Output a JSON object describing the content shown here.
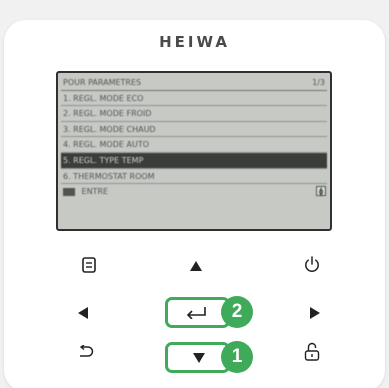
{
  "brand": {
    "name": "HEIWA"
  },
  "screen": {
    "header": {
      "title": "POUR PARAMETRES",
      "page": "1/3"
    },
    "items": [
      {
        "label": "1. REGL. MODE ECO"
      },
      {
        "label": "2. REGL. MODE FROID"
      },
      {
        "label": "3. REGL. MODE CHAUD"
      },
      {
        "label": "4. REGL. MODE AUTO"
      },
      {
        "label": "5. REGL. TYPE TEMP"
      },
      {
        "label": "6. THERMOSTAT ROOM"
      }
    ],
    "selected_index": 4,
    "footer": {
      "label": "ENTRE"
    }
  },
  "steps": {
    "enter_step": "2",
    "down_step": "1"
  },
  "colors": {
    "accent": "#3eaa5a",
    "screen_bg": "#c7c9c5",
    "selected_row": "#3a3d3a"
  },
  "icons": {
    "menu": "menu-icon",
    "up": "arrow-up-icon",
    "power": "power-icon",
    "left": "arrow-left-icon",
    "enter": "enter-icon",
    "right": "arrow-right-icon",
    "back": "back-icon",
    "down": "arrow-down-icon",
    "lock": "lock-icon"
  }
}
